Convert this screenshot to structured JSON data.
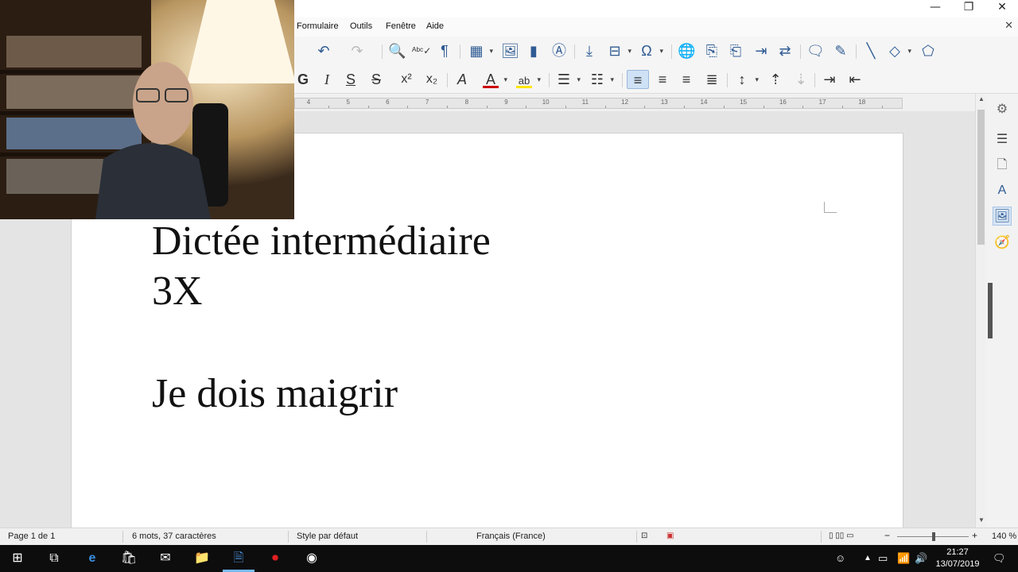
{
  "window": {
    "minimize_glyph": "—",
    "maximize_glyph": "❐",
    "close_glyph": "✕",
    "doc_close_glyph": "✕"
  },
  "menu": {
    "items": [
      "Formulaire",
      "Outils",
      "Fenêtre",
      "Aide"
    ]
  },
  "ruler": {
    "numbers": [
      "4",
      "5",
      "6",
      "7",
      "8",
      "9",
      "10",
      "11",
      "12",
      "13",
      "14",
      "15",
      "16",
      "17",
      "18"
    ]
  },
  "document": {
    "lines": [
      "Dictée intermédiaire",
      "3X",
      "Je dois maigrir"
    ]
  },
  "status": {
    "page": "Page 1 de 1",
    "words": "6 mots, 37 caractères",
    "style": "Style par défaut",
    "language": "Français (France)",
    "zoom": "140 %",
    "zoom_level": 140
  },
  "taskbar": {
    "time": "21:27",
    "date": "13/07/2019"
  },
  "colors": {
    "accent": "#2f5b93",
    "font_color_bar": "#cc0000",
    "highlight_bar": "#ffe600",
    "taskbar": "#0d0d0d"
  }
}
